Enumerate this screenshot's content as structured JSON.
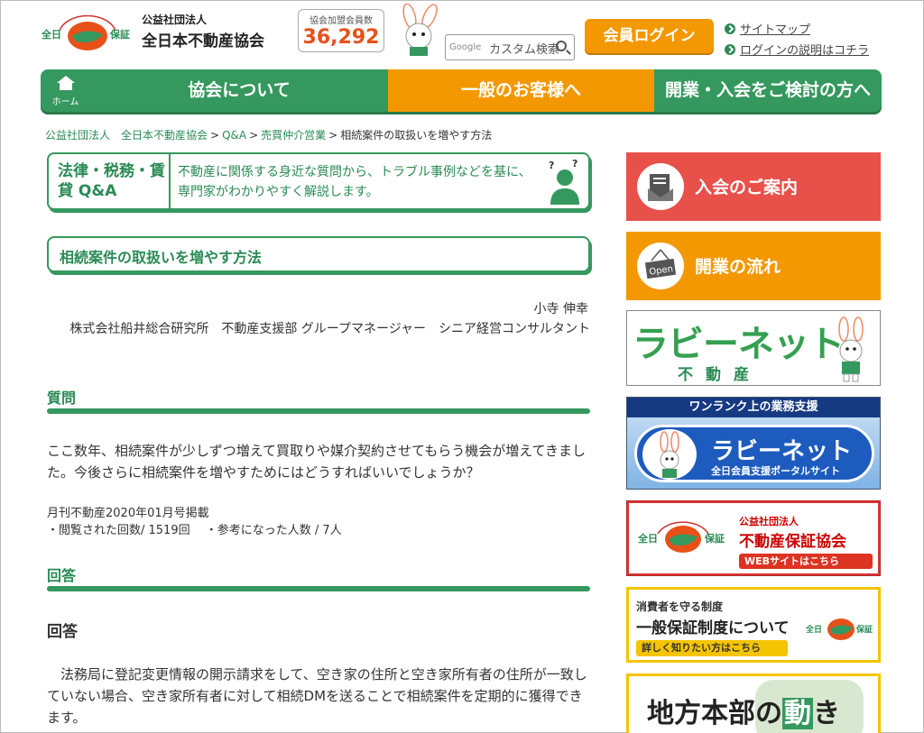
{
  "header": {
    "org_small": "公益社団法人",
    "org_name": "全日本不動産協会",
    "member_label": "協会加盟会員数",
    "member_count": "36,292",
    "search_brand": "Google",
    "search_placeholder": "カスタム検索",
    "login_label": "会員ログイン",
    "links": [
      "サイトマップ",
      "ログインの説明はコチラ"
    ],
    "logo_text": [
      "全日",
      "保証"
    ]
  },
  "nav": {
    "home": "ホーム",
    "items": [
      "協会について",
      "一般のお客様へ",
      "開業・入会をご検討の方へ"
    ]
  },
  "breadcrumb": {
    "items": [
      "公益社団法人　全日本不動産協会",
      "Q&A",
      "売買仲介営業"
    ],
    "current": "相続案件の取扱いを増やす方法",
    "sep": ">"
  },
  "qa_banner": {
    "title": "法律・税務・賃貸 Q&A",
    "desc": "不動産に関係する身近な質問から、トラブル事例などを基に、専門家がわかりやすく解説します。"
  },
  "article": {
    "title": "相続案件の取扱いを増やす方法",
    "author_name": "小寺 伸幸",
    "author_affiliation": "株式会社船井総合研究所　不動産支援部 グループマネージャー　シニア経営コンサルタント",
    "question_heading": "質問",
    "question_text": "ここ数年、相続案件が少しずつ増えて買取りや媒介契約させてもらう機会が増えてきました。今後さらに相続案件を増やすためにはどうすればいいでしょうか？",
    "published": "月刊不動産2020年01月号掲載",
    "stats": "・閲覧された回数/ 1519回　 ・参考になった人数 / 7人",
    "answer_heading": "回答",
    "answer_subheading": "回答",
    "answer_text": "法務局に登記変更情報の開示請求をして、空き家の住所と空き家所有者の住所が一致していない場合、空き家所有者に対して相続DMを送ることで相続案件を定期的に獲得できます。"
  },
  "sidebar": {
    "join": "入会のご案内",
    "open": "開業の流れ",
    "open_sign": "Open",
    "rabbynet_title": "ラビーネット",
    "rabbynet_sub": "不動産",
    "portal_top": "ワンランク上の業務支援",
    "portal_title": "ラビーネット",
    "portal_sub": "全日会員支援ポータルサイト",
    "guarantee_small": "公益社団法人",
    "guarantee_big": "不動産保証協会",
    "guarantee_btn": "WEBサイトはこちら",
    "consumer_small": "消費者を守る制度",
    "consumer_big": "一般保証制度について",
    "consumer_btn": "詳しく知りたい方はこちら",
    "branch_title_a": "地方本部の",
    "branch_title_b": "動",
    "branch_title_c": "き"
  },
  "colors": {
    "green": "#35985e",
    "orange": "#f39800",
    "red": "#e8504a",
    "yellow": "#f5c400"
  }
}
